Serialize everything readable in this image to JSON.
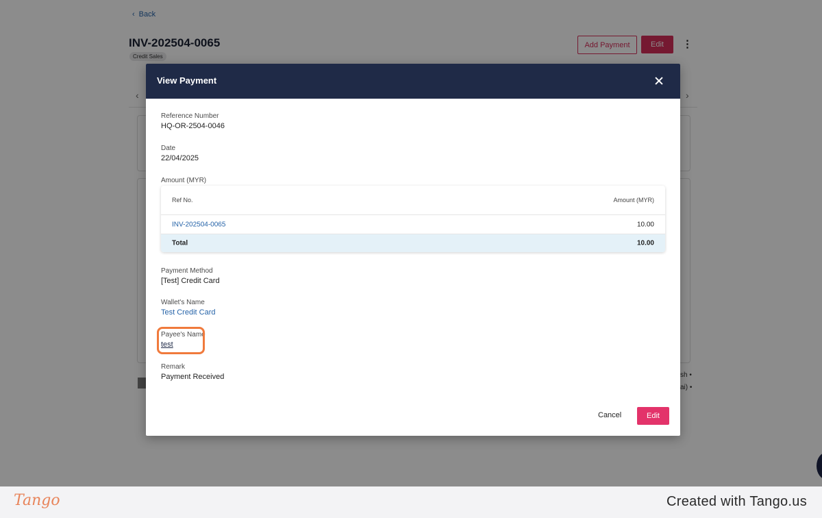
{
  "page": {
    "back_label": "Back",
    "invoice_id": "INV-202504-0065",
    "chip": "Credit Sales",
    "add_payment_label": "Add Payment",
    "edit_label": "Edit",
    "kebab": "⋮",
    "peek_text_1": "sh •",
    "peek_text_2": "ai) •"
  },
  "modal": {
    "title": "View Payment",
    "reference_label": "Reference Number",
    "reference_value": "HQ-OR-2504-0046",
    "date_label": "Date",
    "date_value": "22/04/2025",
    "amount_label": "Amount (MYR)",
    "table": {
      "col_ref": "Ref No.",
      "col_amount": "Amount (MYR)",
      "rows": [
        {
          "ref": "INV-202504-0065",
          "amount": "10.00"
        }
      ],
      "total_label": "Total",
      "total_value": "10.00"
    },
    "method_label": "Payment Method",
    "method_value": "[Test] Credit Card",
    "wallet_label": "Wallet's Name",
    "wallet_value": "Test Credit Card",
    "payee_label": "Payee's Name",
    "payee_value": "test",
    "remark_label": "Remark",
    "remark_value": "Payment Received",
    "cancel_label": "Cancel",
    "edit_label": "Edit"
  },
  "footer": {
    "logo": "Tango",
    "created": "Created with Tango.us"
  },
  "colors": {
    "header_bg": "#1f2a47",
    "accent": "#e3336a",
    "link": "#2563a8",
    "highlight": "#f07a3c"
  }
}
